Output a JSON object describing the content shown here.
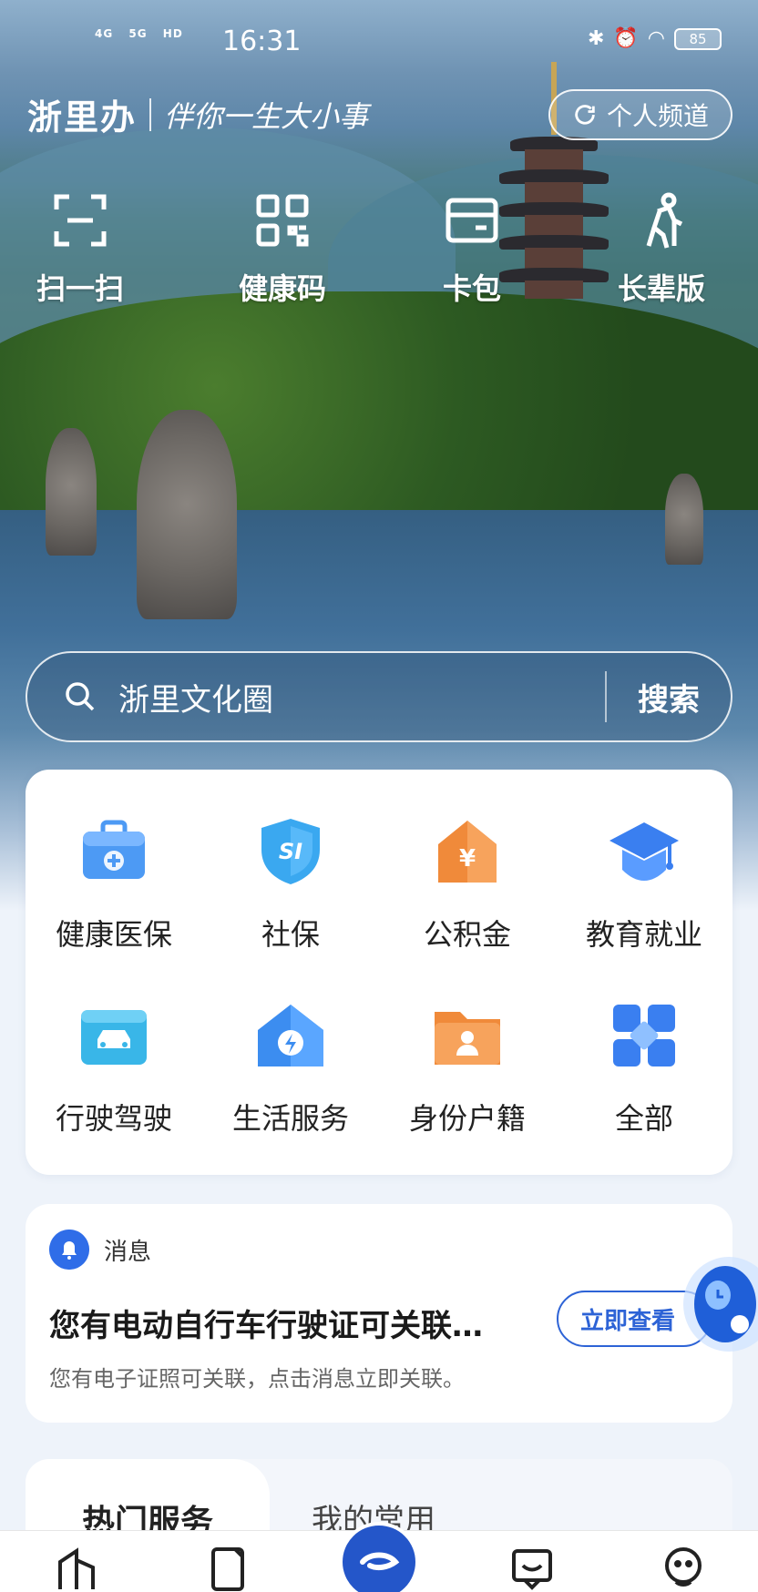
{
  "status_bar": {
    "network_1": "4G",
    "network_2": "5G",
    "hd_badge": "HD",
    "time": "16:31",
    "battery": "85"
  },
  "header": {
    "brand_name": "浙里办",
    "slogan": "伴你一生大小事",
    "channel_button": "个人频道"
  },
  "quick_actions": [
    {
      "label": "扫一扫",
      "icon": "scan-icon"
    },
    {
      "label": "健康码",
      "icon": "qr-code-icon"
    },
    {
      "label": "卡包",
      "icon": "card-wallet-icon"
    },
    {
      "label": "长辈版",
      "icon": "elder-mode-icon"
    }
  ],
  "search": {
    "placeholder": "浙里文化圈",
    "button": "搜索"
  },
  "services": [
    {
      "label": "健康医保",
      "icon": "medical-kit-icon",
      "color": "#4d9af4"
    },
    {
      "label": "社保",
      "icon": "social-security-shield-icon",
      "color": "#3aa8f0"
    },
    {
      "label": "公积金",
      "icon": "housing-fund-icon",
      "color": "#f08a3a"
    },
    {
      "label": "教育就业",
      "icon": "graduation-cap-icon",
      "color": "#3a7ff0"
    },
    {
      "label": "行驶驾驶",
      "icon": "car-license-icon",
      "color": "#39b6e8"
    },
    {
      "label": "生活服务",
      "icon": "home-service-icon",
      "color": "#3c8df0"
    },
    {
      "label": "身份户籍",
      "icon": "id-folder-icon",
      "color": "#f08a3a"
    },
    {
      "label": "全部",
      "icon": "all-grid-icon",
      "color": "#3a7ff0"
    }
  ],
  "message": {
    "tag": "消息",
    "title": "您有电动自行车行驶证可关联…",
    "subtitle": "您有电子证照可关联，点击消息立即关联。",
    "button": "立即查看"
  },
  "tabs": {
    "active": "热门服务",
    "inactive": "我的常用"
  },
  "colors": {
    "accent": "#2d63d6",
    "card_bg": "#ffffff",
    "page_bg": "#eef3fa"
  }
}
